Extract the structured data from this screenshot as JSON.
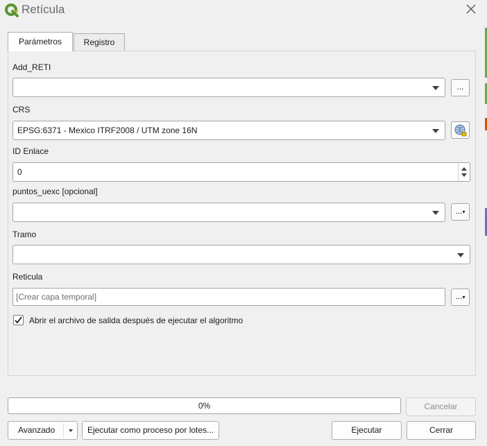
{
  "window": {
    "title": "Retícula"
  },
  "tabs": [
    {
      "label": "Parámetros"
    },
    {
      "label": "Registro"
    }
  ],
  "form": {
    "add_reti": {
      "label": "Add_RETI",
      "value": "",
      "browse_label": "..."
    },
    "crs": {
      "label": "CRS",
      "value": "EPSG:6371 - Mexico ITRF2008 / UTM zone 16N"
    },
    "id_enlace": {
      "label": "ID Enlace",
      "value": "0"
    },
    "puntos_uexc": {
      "label": "puntos_uexc [opcional]",
      "value": "",
      "browse_label": "..."
    },
    "tramo": {
      "label": "Tramo",
      "value": ""
    },
    "reticula": {
      "label": "Reticula",
      "placeholder": "[Crear capa temporal]",
      "browse_label": "..."
    },
    "open_output": {
      "label": "Abrir el archivo de salida después de ejecutar el algoritmo",
      "checked": true
    }
  },
  "progress": {
    "text": "0%",
    "value": 0
  },
  "buttons": {
    "cancel": "Cancelar",
    "advanced": "Avanzado",
    "batch": "Ejecutar como proceso por lotes...",
    "run": "Ejecutar",
    "close": "Cerrar"
  },
  "colors": {
    "accent_green": "#589632",
    "edge_green": "#6aa84f",
    "edge_purple": "#7b6fa8",
    "edge_orange": "#d35400"
  },
  "icons": {
    "app": "qgis-logo-icon",
    "close": "close-icon",
    "crs": "globe-projection-icon",
    "check": "checkmark-icon"
  }
}
